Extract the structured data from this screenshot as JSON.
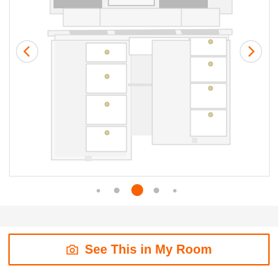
{
  "colors": {
    "accent": "#f96302",
    "dot_inactive": "#b9b9b9",
    "band": "#f5f5f5"
  },
  "gallery": {
    "image_alt": "white vanity desk with hutch and drawers",
    "prev_icon": "chevron-left-icon",
    "next_icon": "chevron-right-icon",
    "active_index": 3,
    "dot_count": 5
  },
  "room_button": {
    "icon": "camera-icon",
    "label": "See This in My Room"
  }
}
